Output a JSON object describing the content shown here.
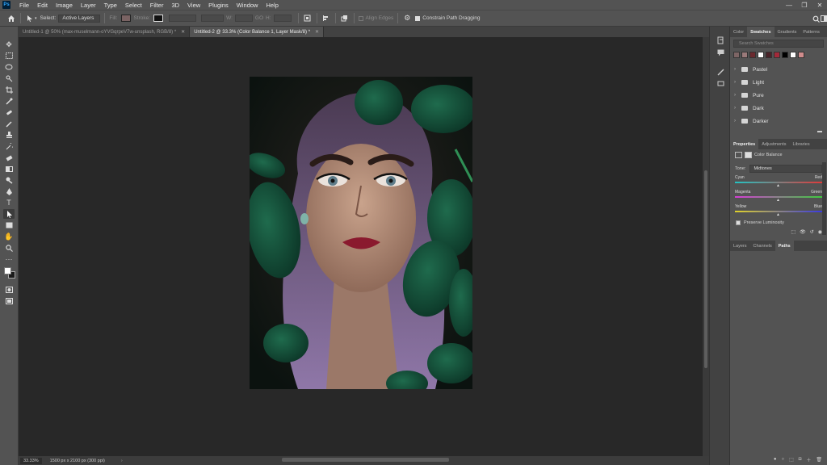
{
  "menubar": {
    "logo": "Ps",
    "items": [
      "File",
      "Edit",
      "Image",
      "Layer",
      "Type",
      "Select",
      "Filter",
      "3D",
      "View",
      "Plugins",
      "Window",
      "Help"
    ],
    "controls": [
      "—",
      "❐",
      "✕"
    ]
  },
  "options": {
    "select_label": "Select:",
    "select_value": "Active Layers",
    "fill_label": "Fill:",
    "stroke_label": "Stroke:",
    "w_label": "W:",
    "h_label": "H:",
    "go_label": "GO",
    "align_edges": "Align Edges",
    "constrain_label": "Constrain Path Dragging"
  },
  "tabs": [
    {
      "label": "Untitled-1 @ 50% (max-muselmann-oYVGqrpeV7w-unsplash, RGB/8) *",
      "active": false
    },
    {
      "label": "Untitled-2 @ 33.3% (Color Balance 1, Layer Mask/8) *",
      "active": true
    }
  ],
  "status": {
    "zoom": "33.33%",
    "doc_info": "1500 px x 2100 px (300 ppi)"
  },
  "right_panel": {
    "top_tabs": [
      "Color",
      "Swatches",
      "Gradients",
      "Patterns"
    ],
    "search_placeholder": "Search Swatches",
    "swatches": [
      "#7d6565",
      "#9a7a7a",
      "#6b2a2f",
      "#ffffff",
      "#4a2228",
      "#a22a3a",
      "#000000",
      "#ffffff",
      "#d08c8c"
    ],
    "folders": [
      "Pastel",
      "Light",
      "Pure",
      "Dark",
      "Darker"
    ],
    "prop_tabs": [
      "Properties",
      "Adjustments",
      "Libraries"
    ],
    "adjustment_name": "Color Balance",
    "tone_label": "Tone:",
    "tone_value": "Midtones",
    "sliders": [
      {
        "left": "Cyan",
        "right": "Red",
        "value": 0
      },
      {
        "left": "Magenta",
        "right": "Green",
        "value": 0
      },
      {
        "left": "Yellow",
        "right": "Blue",
        "value": 0
      }
    ],
    "preserve_label": "Preserve Luminosity",
    "bottom_tabs": [
      "Layers",
      "Channels",
      "Paths"
    ]
  }
}
